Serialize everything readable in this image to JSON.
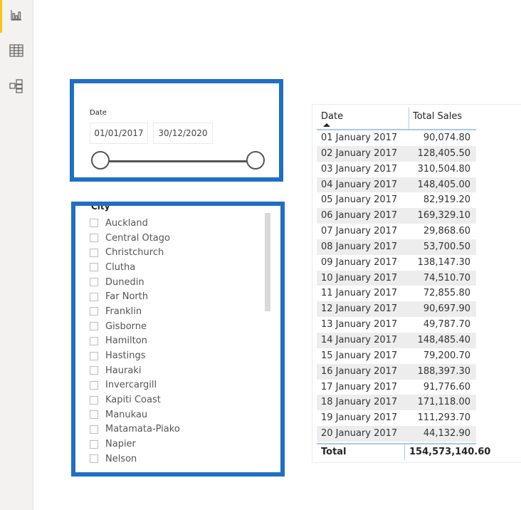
{
  "rail": {
    "items": [
      {
        "name": "report-view",
        "icon": "bar-chart-icon",
        "active": true
      },
      {
        "name": "data-view",
        "icon": "table-icon",
        "active": false
      },
      {
        "name": "model-view",
        "icon": "model-icon",
        "active": false
      }
    ]
  },
  "date_slicer": {
    "title": "Date",
    "from": "01/01/2017",
    "to": "30/12/2020"
  },
  "city_slicer": {
    "title": "City",
    "items": [
      "Auckland",
      "Central Otago",
      "Christchurch",
      "Clutha",
      "Dunedin",
      "Far North",
      "Franklin",
      "Gisborne",
      "Hamilton",
      "Hastings",
      "Hauraki",
      "Invercargill",
      "Kapiti Coast",
      "Manukau",
      "Matamata-Piako",
      "Napier",
      "Nelson"
    ]
  },
  "table": {
    "headers": [
      "Date",
      "Total Sales"
    ],
    "sort": "ascending",
    "rows": [
      [
        "01 January 2017",
        "90,074.80"
      ],
      [
        "02 January 2017",
        "128,405.50"
      ],
      [
        "03 January 2017",
        "310,504.80"
      ],
      [
        "04 January 2017",
        "148,405.00"
      ],
      [
        "05 January 2017",
        "82,919.20"
      ],
      [
        "06 January 2017",
        "169,329.10"
      ],
      [
        "07 January 2017",
        "29,868.60"
      ],
      [
        "08 January 2017",
        "53,700.50"
      ],
      [
        "09 January 2017",
        "138,147.30"
      ],
      [
        "10 January 2017",
        "74,510.70"
      ],
      [
        "11 January 2017",
        "72,855.80"
      ],
      [
        "12 January 2017",
        "90,697.90"
      ],
      [
        "13 January 2017",
        "49,787.70"
      ],
      [
        "14 January 2017",
        "148,485.40"
      ],
      [
        "15 January 2017",
        "79,200.70"
      ],
      [
        "16 January 2017",
        "188,397.30"
      ],
      [
        "17 January 2017",
        "91,776.60"
      ],
      [
        "18 January 2017",
        "171,118.00"
      ],
      [
        "19 January 2017",
        "111,293.70"
      ],
      [
        "20 January 2017",
        "44,132.90"
      ]
    ],
    "total_label": "Total",
    "total_value": "154,573,140.60"
  },
  "colors": {
    "highlight_border": "#1f6fc4",
    "active_accent": "#f2c811",
    "header_line": "#a6cbe8"
  }
}
